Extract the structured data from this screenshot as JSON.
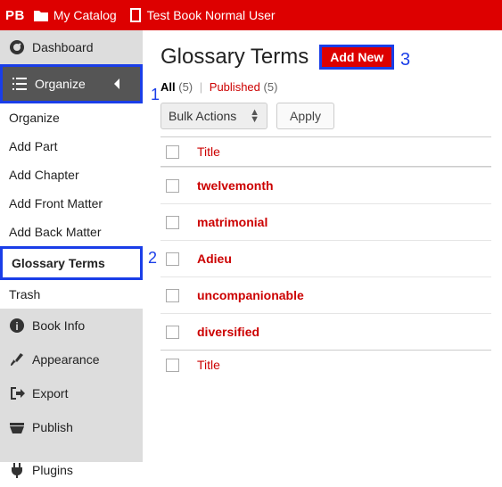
{
  "topbar": {
    "logo": "PB",
    "catalog": "My Catalog",
    "book": "Test Book Normal User"
  },
  "sidebar": {
    "dashboard": "Dashboard",
    "organize": "Organize",
    "sub": {
      "organize": "Organize",
      "add_part": "Add Part",
      "add_chapter": "Add Chapter",
      "add_front": "Add Front Matter",
      "add_back": "Add Back Matter",
      "glossary": "Glossary Terms",
      "trash": "Trash"
    },
    "book_info": "Book Info",
    "appearance": "Appearance",
    "export": "Export",
    "publish": "Publish",
    "plugins": "Plugins"
  },
  "annotations": {
    "one": "1",
    "two": "2",
    "three": "3"
  },
  "page": {
    "title": "Glossary Terms",
    "add": "Add New",
    "filters": {
      "all_label": "All",
      "all_count": "(5)",
      "pub_label": "Published",
      "pub_count": "(5)"
    },
    "bulk_label": "Bulk Actions",
    "apply": "Apply",
    "col_title": "Title",
    "rows": {
      "0": "twelvemonth",
      "1": "matrimonial",
      "2": "Adieu",
      "3": "uncompanionable",
      "4": "diversified"
    },
    "col_title2": "Title"
  }
}
